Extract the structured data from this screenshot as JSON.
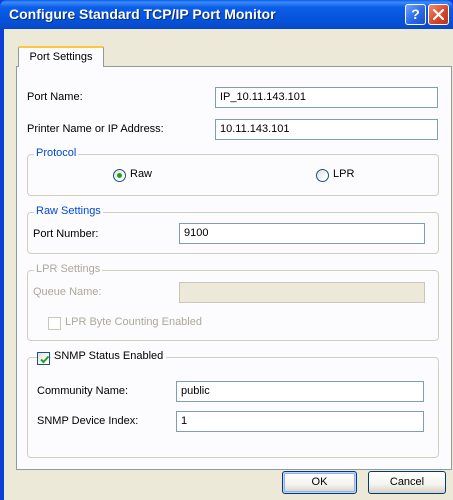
{
  "window": {
    "title": "Configure Standard TCP/IP Port Monitor",
    "help_glyph": "?"
  },
  "tabs": [
    {
      "label": "Port Settings",
      "selected": true
    }
  ],
  "port_name": {
    "label": "Port Name:",
    "value": "IP_10.11.143.101"
  },
  "printer_address": {
    "label": "Printer Name or IP Address:",
    "value": "10.11.143.101"
  },
  "protocol": {
    "legend": "Protocol",
    "options": [
      {
        "label": "Raw",
        "selected": true
      },
      {
        "label": "LPR",
        "selected": false
      }
    ]
  },
  "raw_settings": {
    "legend": "Raw Settings",
    "port_number_label": "Port Number:",
    "port_number_value": "9100"
  },
  "lpr_settings": {
    "legend": "LPR Settings",
    "queue_name_label": "Queue Name:",
    "queue_name_value": "",
    "byte_counting_label": "LPR Byte Counting Enabled",
    "byte_counting_checked": false,
    "enabled": false
  },
  "snmp": {
    "label": "SNMP Status Enabled",
    "checked": true,
    "community_label": "Community Name:",
    "community_value": "public",
    "device_index_label": "SNMP Device Index:",
    "device_index_value": "1"
  },
  "buttons": {
    "ok": "OK",
    "cancel": "Cancel"
  },
  "colors": {
    "title_bar": "#0654dc",
    "dialog_face": "#ece9d8",
    "group_legend": "#0046d5",
    "disabled_text": "#aca899",
    "radio_dot": "#21a121",
    "close_button": "#d9472b"
  }
}
